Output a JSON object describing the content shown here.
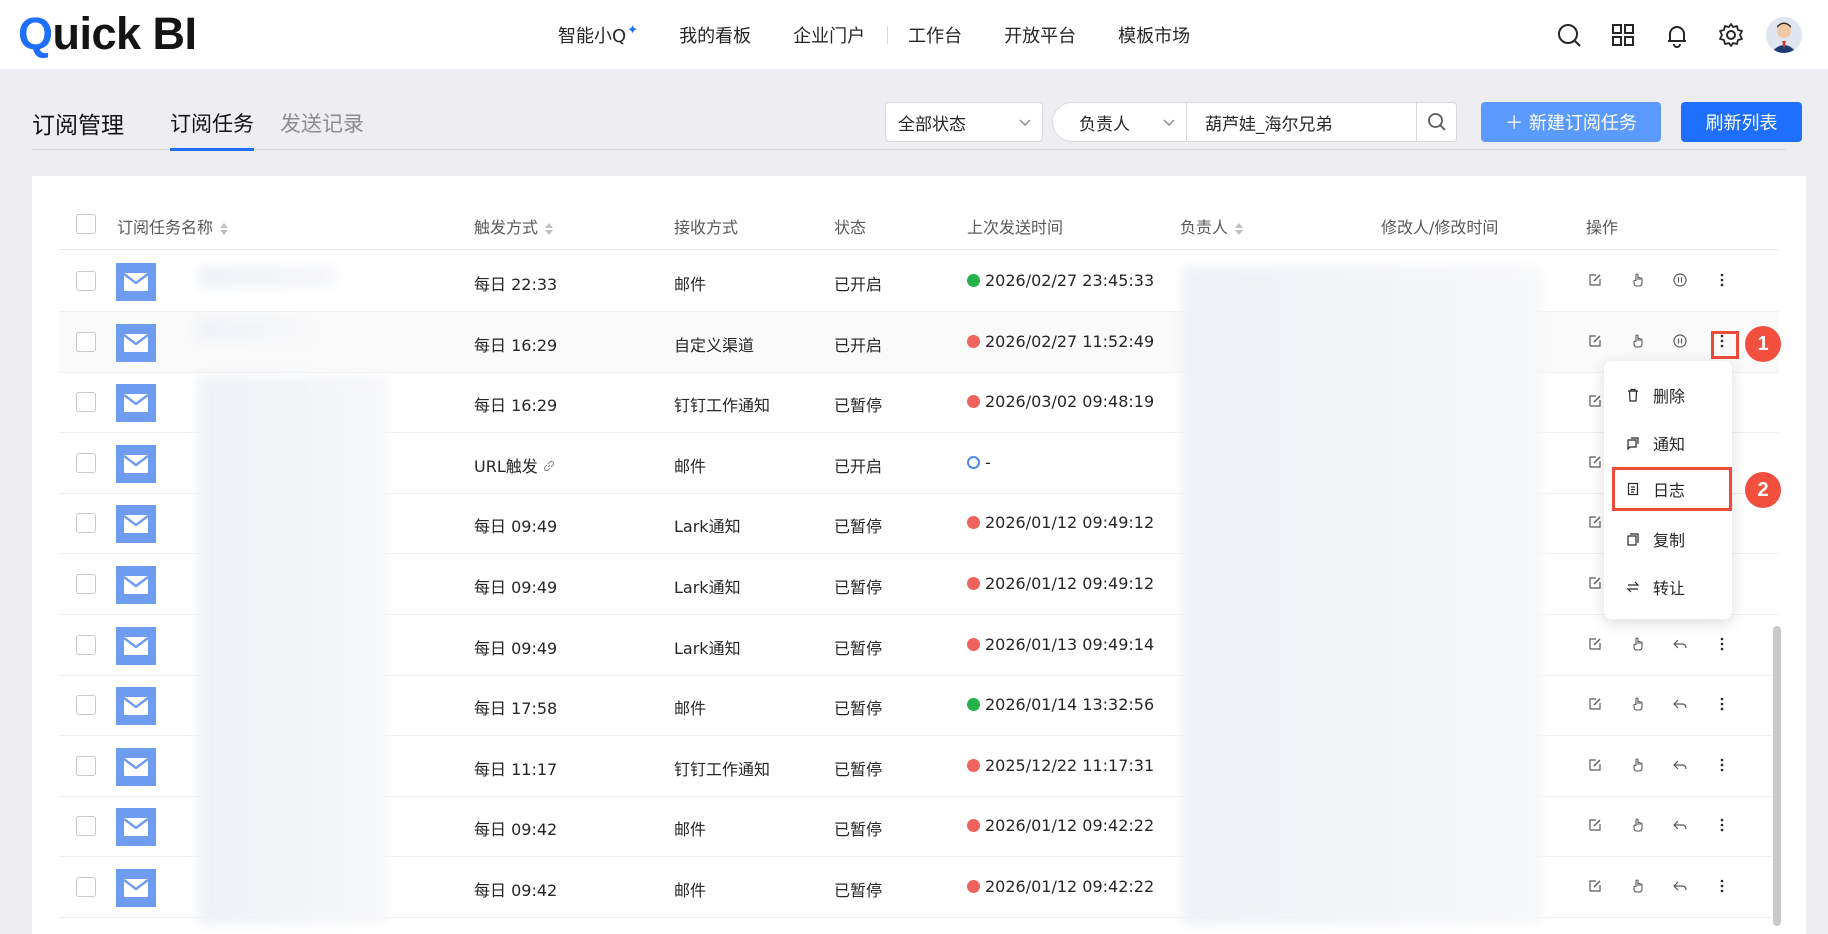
{
  "app": {
    "logo_q": "Q",
    "logo_rest": "uick BI"
  },
  "nav": {
    "items": [
      "智能小Q",
      "我的看板",
      "企业门户",
      "工作台",
      "开放平台",
      "模板市场"
    ],
    "sparkle": "✦"
  },
  "header": {
    "title": "订阅管理",
    "tabs": [
      "订阅任务",
      "发送记录"
    ]
  },
  "filters": {
    "status_value": "全部状态",
    "owner_select": "负责人",
    "owner_input_value": "葫芦娃_海尔兄弟",
    "new_button": "＋ 新建订阅任务",
    "refresh_button": "刷新列表"
  },
  "table": {
    "columns": [
      "订阅任务名称",
      "触发方式",
      "接收方式",
      "状态",
      "上次发送时间",
      "负责人",
      "修改人/修改时间",
      "操作"
    ],
    "rows": [
      {
        "trigger": "每日 22:33",
        "channel": "邮件",
        "status": "已开启",
        "last_send": "2026/02/27 23:45:33",
        "send_state": "ok"
      },
      {
        "trigger": "每日 16:29",
        "channel": "自定义渠道",
        "status": "已开启",
        "last_send": "2026/02/27 11:52:49",
        "send_state": "err"
      },
      {
        "trigger": "每日 16:29",
        "channel": "钉钉工作通知",
        "status": "已暂停",
        "last_send": "2026/03/02 09:48:19",
        "send_state": "err"
      },
      {
        "trigger": "URL触发",
        "channel": "邮件",
        "status": "已开启",
        "last_send": "-",
        "send_state": "pending"
      },
      {
        "trigger": "每日 09:49",
        "channel": "Lark通知",
        "status": "已暂停",
        "last_send": "2026/01/12 09:49:12",
        "send_state": "err"
      },
      {
        "trigger": "每日 09:49",
        "channel": "Lark通知",
        "status": "已暂停",
        "last_send": "2026/01/12 09:49:12",
        "send_state": "err"
      },
      {
        "trigger": "每日 09:49",
        "channel": "Lark通知",
        "status": "已暂停",
        "last_send": "2026/01/13 09:49:14",
        "send_state": "err"
      },
      {
        "trigger": "每日 17:58",
        "channel": "邮件",
        "status": "已暂停",
        "last_send": "2026/01/14 13:32:56",
        "send_state": "ok"
      },
      {
        "trigger": "每日 11:17",
        "channel": "钉钉工作通知",
        "status": "已暂停",
        "last_send": "2025/12/22 11:17:31",
        "send_state": "err"
      },
      {
        "trigger": "每日 09:42",
        "channel": "邮件",
        "status": "已暂停",
        "last_send": "2026/01/12 09:42:22",
        "send_state": "err"
      },
      {
        "trigger": "每日 09:42",
        "channel": "邮件",
        "status": "已暂停",
        "last_send": "2026/01/12 09:42:22",
        "send_state": "err"
      }
    ]
  },
  "dropdown": {
    "items": [
      "删除",
      "通知",
      "日志",
      "复制",
      "转让"
    ]
  },
  "callouts": [
    "1",
    "2"
  ],
  "colors": {
    "primary": "#1f6fff",
    "callout": "#f24f3e",
    "success": "#24b24a",
    "error": "#f0635d",
    "mail_icon": "#6e9cf0"
  }
}
